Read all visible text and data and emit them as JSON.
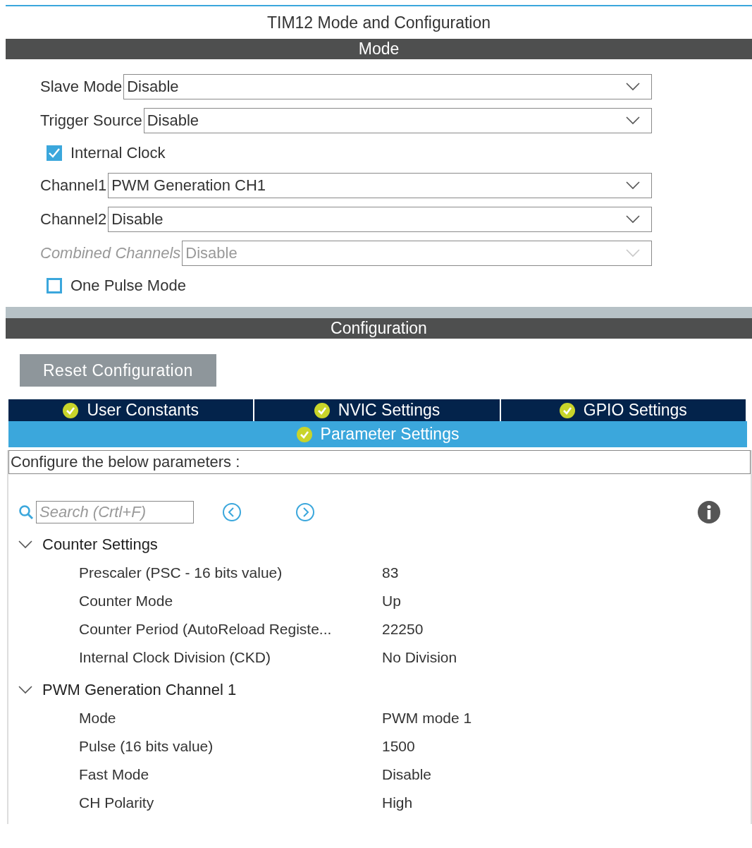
{
  "title": "TIM12 Mode and Configuration",
  "mode": {
    "header": "Mode",
    "fields": [
      {
        "kind": "select",
        "label": "Slave Mode",
        "value": "Disable",
        "disabled": false
      },
      {
        "kind": "select",
        "label": "Trigger Source",
        "value": "Disable",
        "disabled": false
      },
      {
        "kind": "checkbox",
        "label": "Internal Clock",
        "checked": true
      },
      {
        "kind": "select",
        "label": "Channel1",
        "value": "PWM Generation CH1",
        "disabled": false
      },
      {
        "kind": "select",
        "label": "Channel2",
        "value": "Disable",
        "disabled": false
      },
      {
        "kind": "select",
        "label": "Combined Channels",
        "value": "Disable",
        "disabled": true
      },
      {
        "kind": "checkbox",
        "label": "One Pulse Mode",
        "checked": false
      }
    ]
  },
  "configuration": {
    "header": "Configuration",
    "reset_button": "Reset Configuration",
    "tabs": [
      {
        "label": "User Constants",
        "selected": false
      },
      {
        "label": "NVIC Settings",
        "selected": false
      },
      {
        "label": "GPIO Settings",
        "selected": false
      },
      {
        "label": "Parameter Settings",
        "selected": true
      }
    ],
    "description": "Configure the below parameters :",
    "search": {
      "placeholder": "Search (Crtl+F)"
    },
    "groups": [
      {
        "name": "Counter Settings",
        "expanded": true,
        "children": [
          {
            "name": "Prescaler (PSC - 16 bits value)",
            "value": "83"
          },
          {
            "name": "Counter Mode",
            "value": "Up"
          },
          {
            "name": "Counter Period (AutoReload Registe...",
            "value": "22250"
          },
          {
            "name": "Internal Clock Division (CKD)",
            "value": "No Division"
          }
        ]
      },
      {
        "name": "PWM Generation Channel 1",
        "expanded": true,
        "children": [
          {
            "name": "Mode",
            "value": "PWM mode 1"
          },
          {
            "name": "Pulse (16 bits value)",
            "value": "1500"
          },
          {
            "name": "Fast Mode",
            "value": "Disable"
          },
          {
            "name": "CH Polarity",
            "value": "High"
          }
        ]
      }
    ]
  }
}
